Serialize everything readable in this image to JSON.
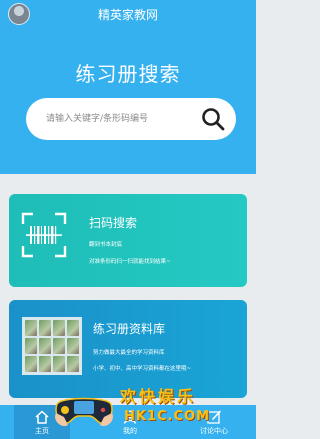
{
  "header": {
    "app_title": "精英家教网",
    "hero_title": "练习册搜索"
  },
  "search": {
    "placeholder": "请输入关键字/条形码编号",
    "value": ""
  },
  "cards": [
    {
      "title": "扫码搜索",
      "lines": [
        "翻到书本封底",
        "对准条形码扫一扫就能找到结果~"
      ]
    },
    {
      "title": "练习册资料库",
      "lines": [
        "努力做最大最全的学习资料库",
        "小学、初中、高中学习资料都在这里哦~"
      ]
    }
  ],
  "tabbar": {
    "items": [
      {
        "label": "主页",
        "icon": "home-icon",
        "active": true
      },
      {
        "label": "我的",
        "icon": "user-icon",
        "active": false
      },
      {
        "label": "讨论中心",
        "icon": "edit-icon",
        "active": false
      }
    ]
  },
  "watermark": {
    "text_cn": "欢快娱乐",
    "url": "HK1C.COM"
  },
  "colors": {
    "primary": "#36b1f0",
    "card_teal": "#1fbdb7",
    "card_blue": "#1a91c9",
    "background": "#e9ecef",
    "watermark": "#f4c21a"
  }
}
